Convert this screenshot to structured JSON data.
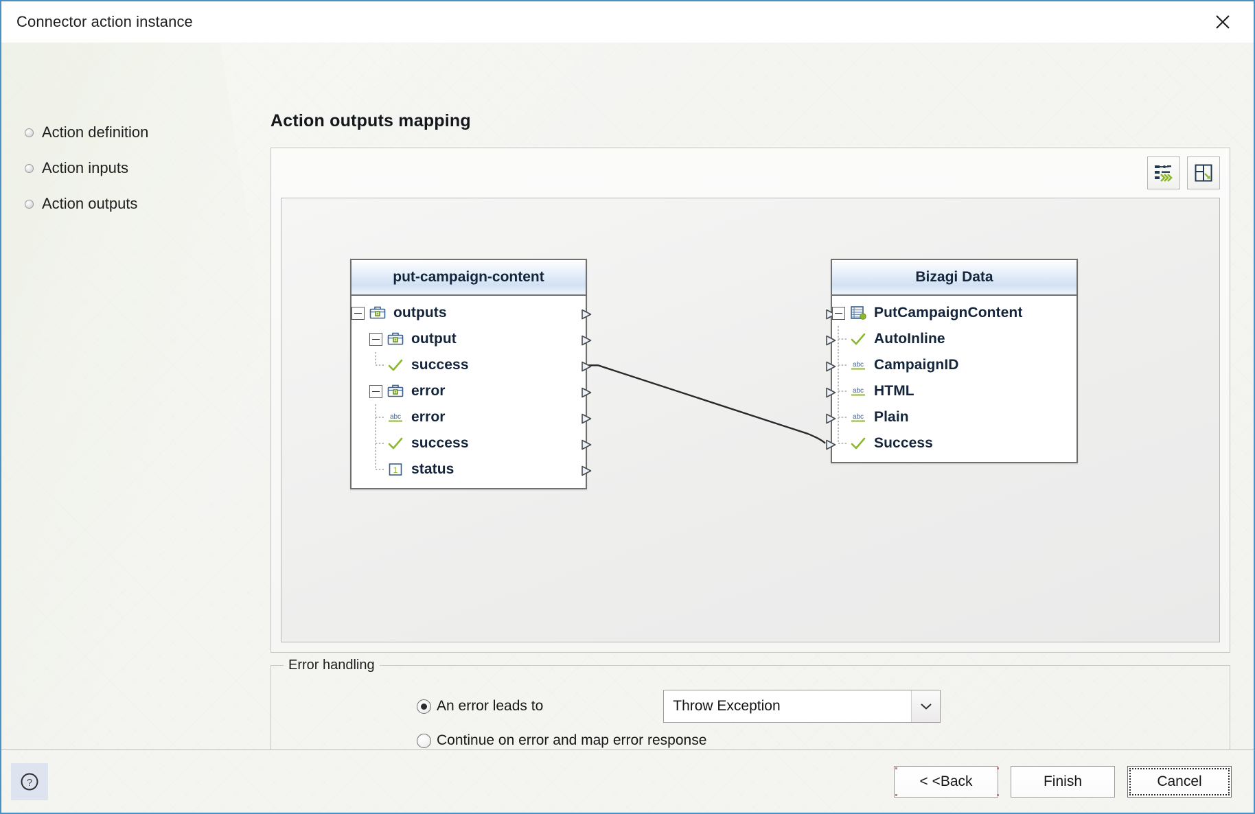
{
  "window": {
    "title": "Connector action instance",
    "close_icon": "close-icon"
  },
  "sidebar": {
    "items": [
      {
        "label": "Action definition",
        "icon": "bullet-icon"
      },
      {
        "label": "Action inputs",
        "icon": "bullet-icon"
      },
      {
        "label": "Action outputs",
        "icon": "bullet-icon"
      }
    ]
  },
  "main": {
    "page_title": "Action outputs mapping",
    "toolbar": {
      "auto_map_label": "auto-map-icon",
      "fit_layout_label": "fit-layout-icon"
    }
  },
  "mapping": {
    "source_panel": {
      "title": "put-campaign-content",
      "rows": [
        {
          "label": "outputs",
          "icon": "briefcase-icon",
          "indent": 0,
          "expander": "minus",
          "guide": "none"
        },
        {
          "label": "output",
          "icon": "briefcase-icon",
          "indent": 1,
          "expander": "minus",
          "guide": "none"
        },
        {
          "label": "success",
          "icon": "check-icon",
          "indent": 2,
          "expander": "none",
          "guide": "last"
        },
        {
          "label": "error",
          "icon": "briefcase-icon",
          "indent": 1,
          "expander": "minus",
          "guide": "none"
        },
        {
          "label": "error",
          "icon": "abc-icon",
          "indent": 2,
          "expander": "none",
          "guide": "tee"
        },
        {
          "label": "success",
          "icon": "check-icon",
          "indent": 2,
          "expander": "none",
          "guide": "tee"
        },
        {
          "label": "status",
          "icon": "number-icon",
          "indent": 2,
          "expander": "none",
          "guide": "last"
        }
      ]
    },
    "target_panel": {
      "title": "Bizagi Data",
      "rows": [
        {
          "label": "PutCampaignContent",
          "icon": "entity-icon",
          "indent": 0,
          "expander": "minus",
          "guide": "none"
        },
        {
          "label": "AutoInline",
          "icon": "check-icon",
          "indent": 1,
          "expander": "none",
          "guide": "tee"
        },
        {
          "label": "CampaignID",
          "icon": "abc-icon",
          "indent": 1,
          "expander": "none",
          "guide": "tee"
        },
        {
          "label": "HTML",
          "icon": "abc-icon",
          "indent": 1,
          "expander": "none",
          "guide": "tee"
        },
        {
          "label": "Plain",
          "icon": "abc-icon",
          "indent": 1,
          "expander": "none",
          "guide": "tee"
        },
        {
          "label": "Success",
          "icon": "check-icon",
          "indent": 1,
          "expander": "none",
          "guide": "last"
        }
      ]
    },
    "links": [
      {
        "from_row": 2,
        "to_row": 5
      }
    ]
  },
  "error_handling": {
    "legend": "Error handling",
    "option_leads_to": "An error leads to",
    "option_continue": "Continue on error and map error response",
    "selected_option": "leads_to",
    "dropdown_value": "Throw Exception"
  },
  "footer": {
    "help_icon": "help-icon",
    "back_label": "< <Back",
    "finish_label": "Finish",
    "cancel_label": "Cancel"
  },
  "colors": {
    "accent_blue": "#4a90c2",
    "header_blue": "#d2e1f3",
    "icon_green": "#8cb82b",
    "border_gray": "#6f6f6f"
  }
}
